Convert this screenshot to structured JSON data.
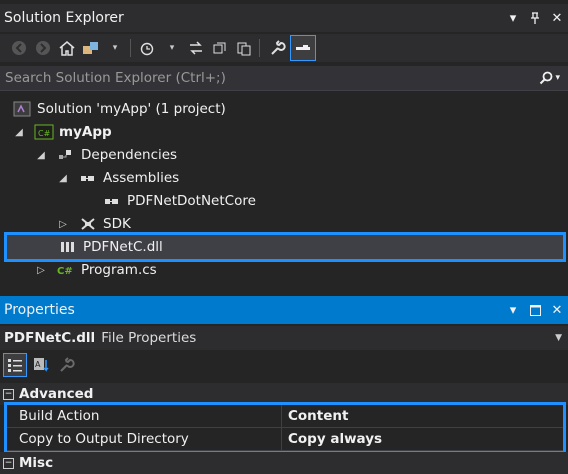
{
  "solution_explorer": {
    "title": "Solution Explorer",
    "search_placeholder": "Search Solution Explorer (Ctrl+;)",
    "tree": {
      "solution": "Solution 'myApp' (1 project)",
      "project": "myApp",
      "dependencies": "Dependencies",
      "assemblies": "Assemblies",
      "assembly_item": "PDFNetDotNetCore",
      "sdk": "SDK",
      "selected_file": "PDFNetC.dll",
      "program": "Program.cs"
    }
  },
  "properties": {
    "title": "Properties",
    "object_name": "PDFNetC.dll",
    "object_kind": "File Properties",
    "categories": {
      "advanced": "Advanced",
      "misc": "Misc"
    },
    "rows": [
      {
        "name": "Build Action",
        "value": "Content"
      },
      {
        "name": "Copy to Output Directory",
        "value": "Copy always"
      }
    ]
  },
  "colors": {
    "accent": "#007acc",
    "highlight_border": "#1e90ff",
    "background": "#252526"
  }
}
